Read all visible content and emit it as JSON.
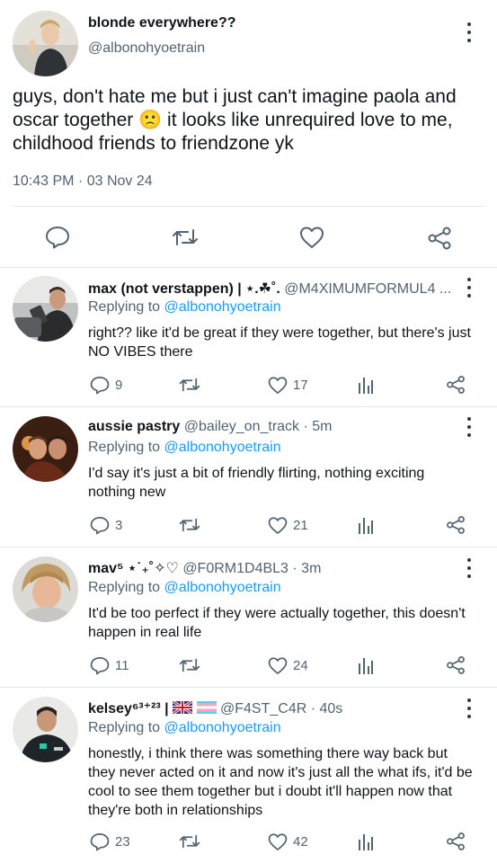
{
  "main_tweet": {
    "display_name": "blonde everywhere??",
    "handle": "@albonohyoetrain",
    "text": "guys, don't hate me but i just can't imagine paola and oscar together 🙁 it looks like unrequired love to me, childhood friends to friendzone yk",
    "timestamp": "10:43 PM · 03 Nov 24",
    "actions": [
      "reply-icon",
      "retweet-icon",
      "like-icon",
      "share-icon"
    ]
  },
  "replies": [
    {
      "display_name": "max (not verstappen) | ⋆.☘︎˚.",
      "handle": "@M4XIMUMFORMUL4 ...",
      "time": "",
      "replying_prefix": "Replying to",
      "replying_to": "@albonohyoetrain",
      "text": "right?? like it'd be great if they were together, but there's just NO VIBES there",
      "reply_count": "9",
      "retweet_count": "",
      "like_count": "17"
    },
    {
      "display_name": "aussie pastry",
      "handle": "@bailey_on_track",
      "time": "· 5m",
      "replying_prefix": "Replying to",
      "replying_to": "@albonohyoetrain",
      "text": "I'd say it's just a bit of friendly flirting, nothing exciting nothing new",
      "reply_count": "3",
      "retweet_count": "",
      "like_count": "21"
    },
    {
      "display_name": "mav⁵ ⋆˙₊˚✧♡",
      "handle": "@F0RM1D4BL3",
      "time": "· 3m",
      "replying_prefix": "Replying to",
      "replying_to": "@albonohyoetrain",
      "text": "It'd be too perfect if they were actually together, this doesn't happen in real life",
      "reply_count": "11",
      "retweet_count": "",
      "like_count": "24"
    },
    {
      "display_name": "kelsey⁶³⁺²³ |",
      "handle": "@F4ST_C4R",
      "time": "· 40s",
      "replying_prefix": "Replying to",
      "replying_to": "@albonohyoetrain",
      "text": "honestly, i think there was something there way back but they never acted on it and now it's just all the what ifs, it'd be cool to see them together but i doubt it'll happen now that they're both in relationships",
      "reply_count": "23",
      "retweet_count": "",
      "like_count": "42"
    }
  ],
  "colors": {
    "link": "#1d9bf0",
    "muted": "#536471",
    "text": "#0f1419",
    "divider": "#e3e8eb"
  }
}
